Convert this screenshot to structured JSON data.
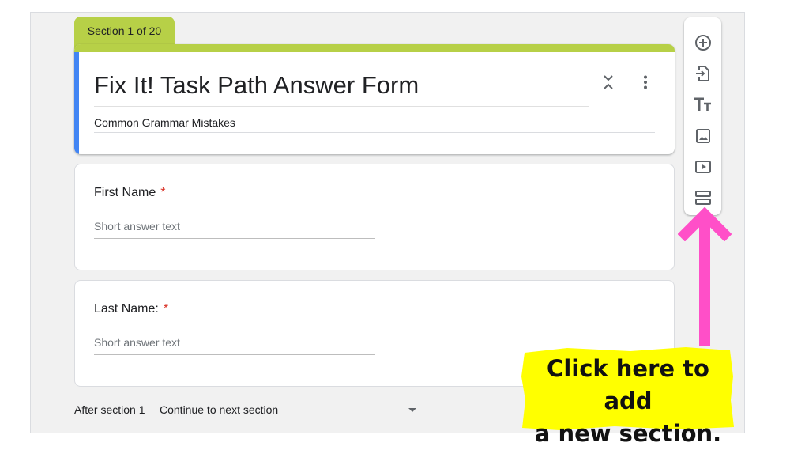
{
  "section_tab": {
    "label": "Section 1 of 20"
  },
  "form": {
    "title": "Fix It! Task Path Answer Form",
    "description": "Common Grammar Mistakes"
  },
  "questions": [
    {
      "label": "First Name",
      "required_mark": "*",
      "hint": "Short answer text"
    },
    {
      "label": "Last Name:",
      "required_mark": "*",
      "hint": "Short answer text"
    }
  ],
  "after_section": {
    "label": "After section 1",
    "value": "Continue to next section"
  },
  "toolbar": {
    "items": [
      "add-question-icon",
      "import-questions-icon",
      "add-title-icon",
      "add-image-icon",
      "add-video-icon",
      "add-section-icon"
    ]
  },
  "callout": {
    "line1": "Click here to add",
    "line2": "a new section."
  },
  "colors": {
    "theme": "#b7d047",
    "accent_bar": "#4285f4",
    "required": "#d93025",
    "arrow": "#ff4fc8",
    "highlight": "#ffff00"
  }
}
